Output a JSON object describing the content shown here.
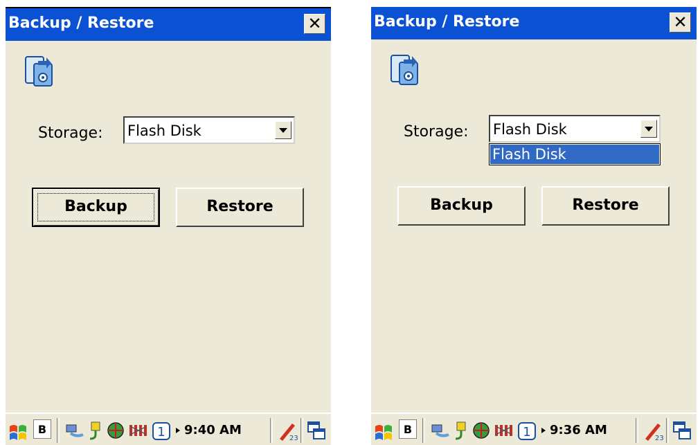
{
  "screens": [
    {
      "title": "Backup / Restore",
      "close_glyph": "✕",
      "app_icon": "backup-device-icon",
      "storage_label": "Storage:",
      "storage_value": "Flash Disk",
      "dropdown_open": false,
      "backup_label": "Backup",
      "restore_label": "Restore",
      "focused_button": "backup",
      "taskbar": {
        "input_indicator": "B",
        "clock": "9:40 AM",
        "icons": [
          "windows-start-icon",
          "network-icon",
          "power-plug-icon",
          "globe-icon",
          "signal-bars-icon",
          "number-one-icon",
          "expand-arrow-icon",
          "input-panel-icon",
          "desktop-switch-icon"
        ]
      }
    },
    {
      "title": "Backup / Restore",
      "close_glyph": "✕",
      "app_icon": "backup-device-icon",
      "storage_label": "Storage:",
      "storage_value": "Flash Disk",
      "dropdown_open": true,
      "dropdown_options": [
        "Flash Disk"
      ],
      "backup_label": "Backup",
      "restore_label": "Restore",
      "focused_button": "",
      "taskbar": {
        "input_indicator": "B",
        "clock": "9:36 AM",
        "icons": [
          "windows-start-icon",
          "network-icon",
          "power-plug-icon",
          "globe-icon",
          "signal-bars-icon",
          "number-one-icon",
          "expand-arrow-icon",
          "input-panel-icon",
          "desktop-switch-icon"
        ]
      }
    }
  ],
  "colors": {
    "titlebar": "#0a51d4",
    "window_bg": "#ece9d8",
    "selection": "#316ac5"
  }
}
